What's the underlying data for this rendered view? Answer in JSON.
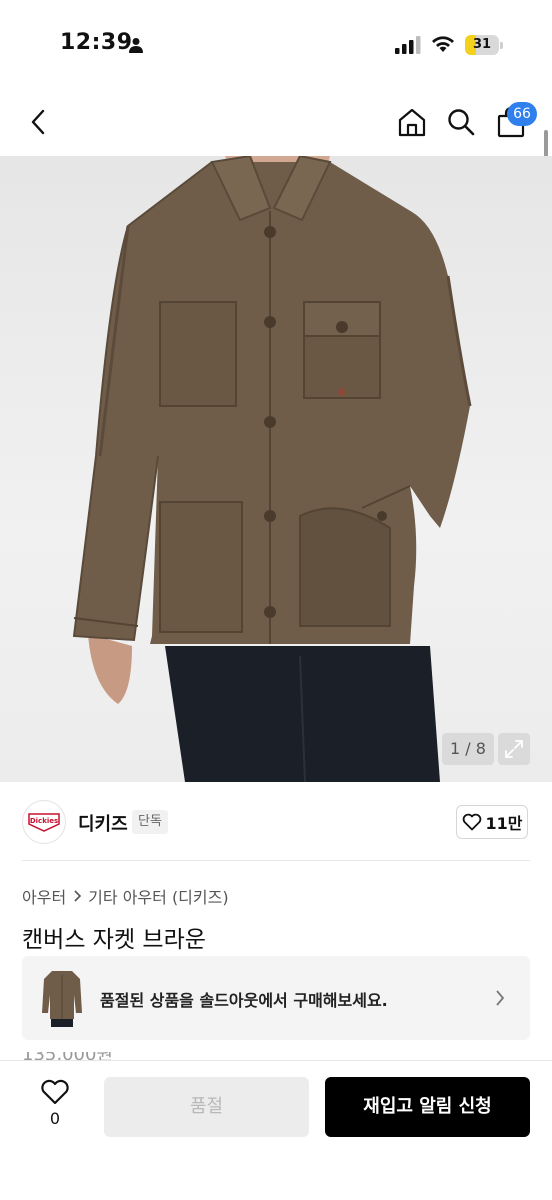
{
  "status": {
    "time": "12:39",
    "battery": "31",
    "battery_level": 0.31,
    "colors": {
      "battery_fill": "#f4d21b"
    }
  },
  "header": {
    "icons": [
      "back-icon",
      "home-icon",
      "search-icon",
      "cart-icon"
    ],
    "cart_badge": "66",
    "colors": {
      "badge": "#2f80ed"
    }
  },
  "gallery": {
    "page_indicator": "1 / 8"
  },
  "brand": {
    "logo_text": "Dickies",
    "name": "디키즈",
    "tag": "단독",
    "likes": "11만"
  },
  "product": {
    "breadcrumb": [
      "아우터",
      "기타 아우터 (디키즈)"
    ],
    "title": "캔버스 자켓 브라운",
    "price_peek": "135,000원"
  },
  "soldout_banner": {
    "text": "품절된 상품을 솔드아웃에서 구매해보세요."
  },
  "bottom": {
    "wish_count": "0",
    "soldout_label": "품절",
    "restock_label": "재입고 알림 신청"
  }
}
